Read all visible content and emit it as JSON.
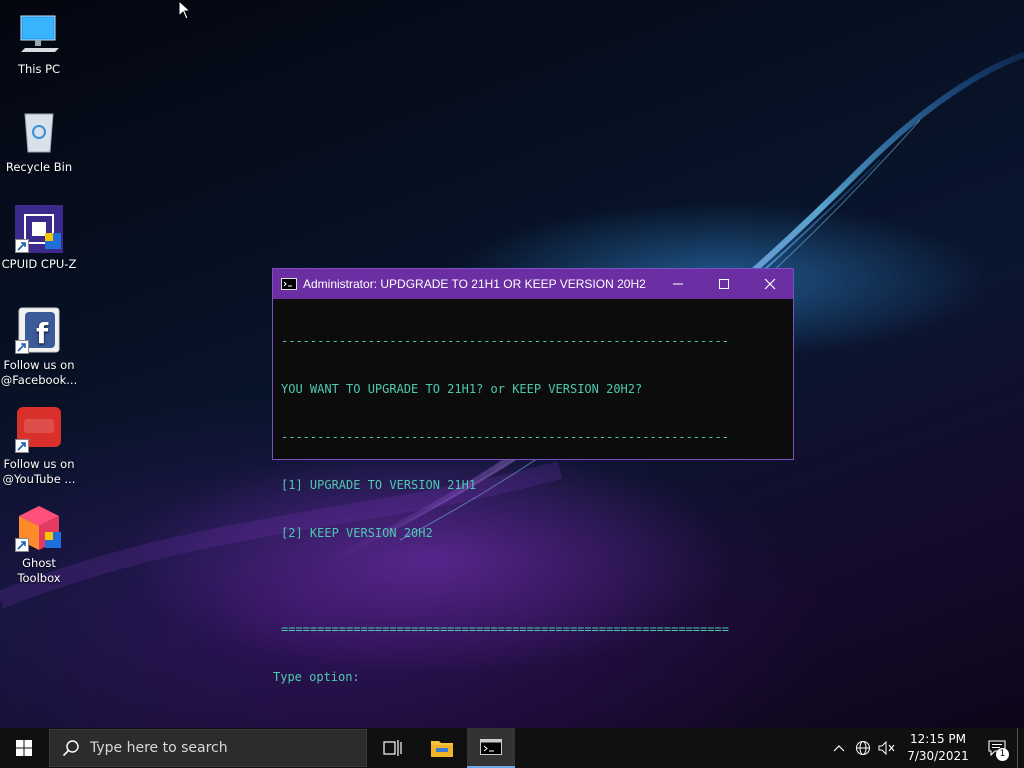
{
  "desktop": {
    "icons": [
      {
        "label": "This PC"
      },
      {
        "label": "Recycle Bin"
      },
      {
        "label": "CPUID CPU-Z"
      },
      {
        "label": "Follow us on @Facebook..."
      },
      {
        "label": "Follow us on @YouTube ..."
      },
      {
        "label": "Ghost Toolbox"
      }
    ]
  },
  "window": {
    "title": "Administrator:  UPDGRADE TO 21H1 OR KEEP VERSION 20H2",
    "lines": [
      "--------------------------------------------------------------",
      "YOU WANT TO UPGRADE TO 21H1? or KEEP VERSION 20H2?",
      "--------------------------------------------------------------",
      "[1] UPGRADE TO VERSION 21H1",
      "[2] KEEP VERSION 20H2",
      "==============================================================",
      "Type option:"
    ],
    "controls": {
      "minimize": "minimize",
      "maximize": "maximize",
      "close": "close"
    }
  },
  "taskbar": {
    "search_placeholder": "Type here to search",
    "clock_time": "12:15 PM",
    "clock_date": "7/30/2021",
    "notification_count": "1"
  },
  "colors": {
    "titlebar": "#6b2fa3",
    "console_text": "#4ec9b0",
    "taskbar": "#101010"
  }
}
